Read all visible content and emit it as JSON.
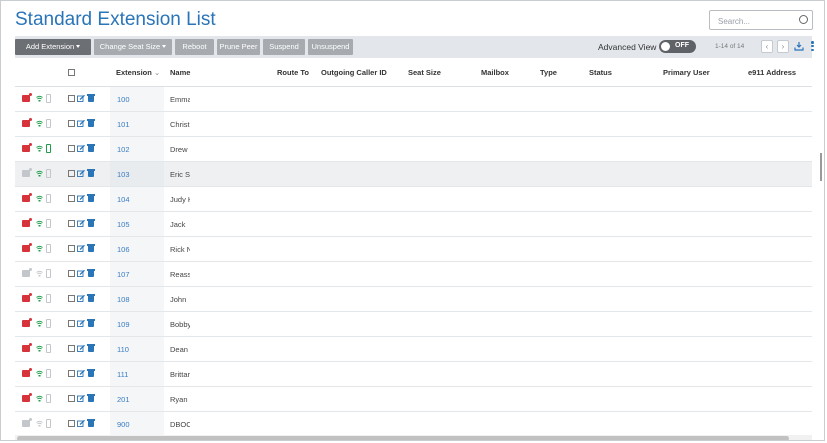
{
  "page_title": "Standard Extension List",
  "search": {
    "placeholder": "Search..."
  },
  "toolbar": {
    "buttons": [
      {
        "label": "Add Extension",
        "dropdown": true,
        "style": "dark"
      },
      {
        "label": "Change Seat Size",
        "dropdown": true,
        "style": "light"
      },
      {
        "label": "Reboot",
        "dropdown": false,
        "style": "light"
      },
      {
        "label": "Prune Peer",
        "dropdown": false,
        "style": "light"
      },
      {
        "label": "Suspend",
        "dropdown": false,
        "style": "light"
      },
      {
        "label": "Unsuspend",
        "dropdown": false,
        "style": "light"
      }
    ],
    "advanced_view_label": "Advanced View",
    "advanced_view_state": "OFF",
    "paging_text": "1-14 of 14",
    "prev_icon": "chevron-left-icon",
    "next_icon": "chevron-right-icon",
    "download_icon": "download-icon",
    "more_icon": "more-vertical-icon"
  },
  "columns": {
    "extension": "Extension",
    "name": "Name",
    "route_to": "Route To",
    "outgoing_caller_id": "Outgoing Caller ID",
    "seat_size": "Seat Size",
    "mailbox": "Mailbox",
    "type": "Type",
    "status": "Status",
    "primary_user": "Primary User",
    "e911_address": "e911 Address"
  },
  "rows": [
    {
      "extension": "100",
      "name": "Emma",
      "phone": "red",
      "wifi": "green",
      "mobile": "gray"
    },
    {
      "extension": "101",
      "name": "Christi",
      "phone": "red",
      "wifi": "green",
      "mobile": "gray"
    },
    {
      "extension": "102",
      "name": "Drew I",
      "phone": "red",
      "wifi": "green",
      "mobile": "green"
    },
    {
      "extension": "103",
      "name": "Eric Su",
      "phone": "gray",
      "wifi": "green",
      "mobile": "gray",
      "highlighted": true
    },
    {
      "extension": "104",
      "name": "Judy H",
      "phone": "red",
      "wifi": "green",
      "mobile": "gray"
    },
    {
      "extension": "105",
      "name": "Jack",
      "phone": "red",
      "wifi": "green",
      "mobile": "gray"
    },
    {
      "extension": "106",
      "name": "Rick N",
      "phone": "red",
      "wifi": "green",
      "mobile": "gray"
    },
    {
      "extension": "107",
      "name": "Reasse",
      "phone": "gray",
      "wifi": "gray",
      "mobile": "gray"
    },
    {
      "extension": "108",
      "name": "John",
      "phone": "red",
      "wifi": "green",
      "mobile": "gray"
    },
    {
      "extension": "109",
      "name": "Bobby",
      "phone": "red",
      "wifi": "green",
      "mobile": "gray"
    },
    {
      "extension": "110",
      "name": "Dean I",
      "phone": "red",
      "wifi": "green",
      "mobile": "gray"
    },
    {
      "extension": "111",
      "name": "Brittar",
      "phone": "red",
      "wifi": "green",
      "mobile": "gray"
    },
    {
      "extension": "201",
      "name": "Ryan I",
      "phone": "red",
      "wifi": "green",
      "mobile": "gray"
    },
    {
      "extension": "900",
      "name": "DBOCI",
      "phone": "gray",
      "wifi": "gray",
      "mobile": "gray"
    }
  ],
  "colors": {
    "accent": "#2a74b8",
    "red": "#d6333a",
    "green": "#1e9e4a",
    "gray": "#c3c7cb"
  }
}
